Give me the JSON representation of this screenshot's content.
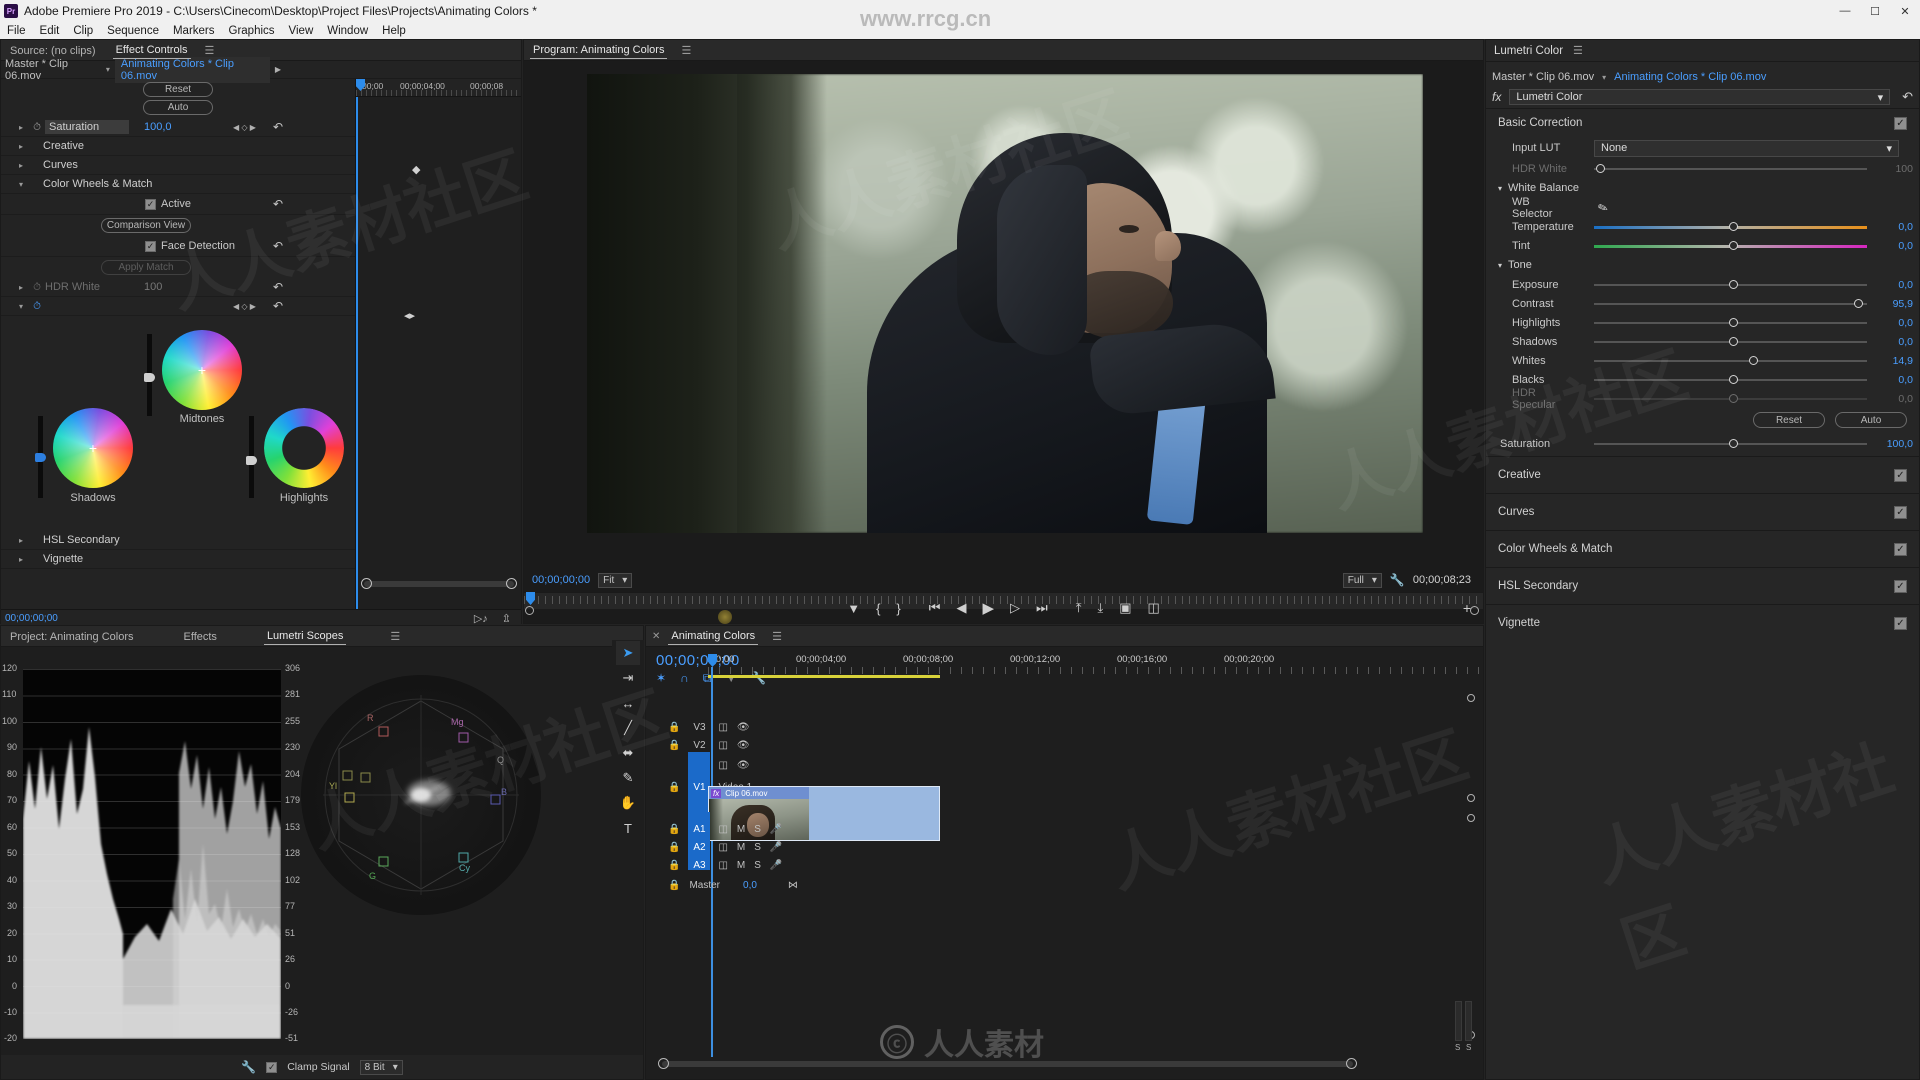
{
  "titlebar": {
    "app_icon": "premiere-logo",
    "title": "Adobe Premiere Pro 2019 - C:\\Users\\Cinecom\\Desktop\\Project Files\\Projects\\Animating Colors *",
    "minimize": "—",
    "maximize": "☐",
    "close": "✕"
  },
  "menubar": {
    "items": [
      "File",
      "Edit",
      "Clip",
      "Sequence",
      "Markers",
      "Graphics",
      "View",
      "Window",
      "Help"
    ]
  },
  "watermark": {
    "top": "www.rrcg.cn",
    "brand": "人人素材"
  },
  "effect_controls": {
    "tabs": [
      {
        "label": "Source: (no clips)",
        "active": false
      },
      {
        "label": "Effect Controls",
        "active": true
      }
    ],
    "menu_icon": "hamburger-icon",
    "master_clip": "Master * Clip 06.mov",
    "sequence_clip": "Animating Colors * Clip 06.mov",
    "ruler_ticks": [
      "00;00",
      "00;00;04;00",
      "00;00;08"
    ],
    "buttons": {
      "reset": "Reset",
      "auto": "Auto",
      "comparison_view": "Comparison View",
      "apply_match": "Apply Match"
    },
    "rows": [
      {
        "label": "Saturation",
        "value": "100,0",
        "indent": 1,
        "selected": true,
        "stopwatch": true
      },
      {
        "label": "Creative",
        "value": "",
        "indent": 0
      },
      {
        "label": "Curves",
        "value": "",
        "indent": 0
      },
      {
        "label": "Color Wheels & Match",
        "value": "",
        "indent": 0,
        "expanded": true
      },
      {
        "label": "HDR White",
        "value": "100",
        "indent": 1,
        "dim": true,
        "stopwatch": true
      }
    ],
    "checkboxes": [
      {
        "label": "Active",
        "checked": true
      },
      {
        "label": "Face Detection",
        "checked": true
      }
    ],
    "wheels": [
      {
        "label": "Midtones",
        "type": "solid"
      },
      {
        "label": "Shadows",
        "type": "solid"
      },
      {
        "label": "Highlights",
        "type": "ring"
      }
    ],
    "bottom_rows": [
      {
        "label": "HSL Secondary"
      },
      {
        "label": "Vignette"
      }
    ],
    "footer_timecode": "00;00;00;00"
  },
  "program_monitor": {
    "tab_label": "Program: Animating Colors",
    "menu_icon": "hamburger-icon",
    "current_timecode": "00;00;00;00",
    "fit_label": "Fit",
    "quality_label": "Full",
    "duration_timecode": "00;00;08;23",
    "settings_icon": "wrench-icon",
    "transport": [
      {
        "name": "add-marker-icon",
        "glyph": "▼"
      },
      {
        "name": "mark-in-icon",
        "glyph": "{"
      },
      {
        "name": "mark-out-icon",
        "glyph": "}"
      },
      {
        "name": "go-to-in-icon",
        "glyph": "⏮"
      },
      {
        "name": "step-back-icon",
        "glyph": "◀"
      },
      {
        "name": "play-icon",
        "glyph": "▶"
      },
      {
        "name": "step-forward-icon",
        "glyph": "▷"
      },
      {
        "name": "go-to-out-icon",
        "glyph": "⏭"
      },
      {
        "name": "lift-icon",
        "glyph": "⤒"
      },
      {
        "name": "extract-icon",
        "glyph": "⤓"
      },
      {
        "name": "export-frame-icon",
        "glyph": "▣"
      },
      {
        "name": "comparison-view-icon",
        "glyph": "◫"
      }
    ],
    "plus_button": "+"
  },
  "lumetri": {
    "panel_title": "Lumetri Color",
    "menu_icon": "hamburger-icon",
    "master_clip": "Master * Clip 06.mov",
    "sequence_clip": "Animating Colors * Clip 06.mov",
    "fx_label": "fx",
    "effect_name": "Lumetri Color",
    "reset_icon": "reset-icon",
    "sections": [
      {
        "name": "Basic Correction",
        "checked": true,
        "input_lut": {
          "label": "Input LUT",
          "value": "None"
        },
        "hdr_white": {
          "label": "HDR White",
          "value": "100",
          "dim": true,
          "knob_pct": 2
        },
        "groups": [
          {
            "name": "White Balance",
            "wb_selector": {
              "label": "WB Selector",
              "icon": "eyedropper-icon"
            },
            "sliders": [
              {
                "label": "Temperature",
                "value": "0,0",
                "knob_pct": 50,
                "gradient": "temperature"
              },
              {
                "label": "Tint",
                "value": "0,0",
                "knob_pct": 50,
                "gradient": "tint"
              }
            ]
          },
          {
            "name": "Tone",
            "sliders": [
              {
                "label": "Exposure",
                "value": "0,0",
                "knob_pct": 50
              },
              {
                "label": "Contrast",
                "value": "95,9",
                "knob_pct": 97
              },
              {
                "label": "Highlights",
                "value": "0,0",
                "knob_pct": 50
              },
              {
                "label": "Shadows",
                "value": "0,0",
                "knob_pct": 50
              },
              {
                "label": "Whites",
                "value": "14,9",
                "knob_pct": 58
              },
              {
                "label": "Blacks",
                "value": "0,0",
                "knob_pct": 50
              },
              {
                "label": "HDR Specular",
                "value": "0,0",
                "knob_pct": 50,
                "dim": true
              }
            ],
            "buttons": {
              "reset": "Reset",
              "auto": "Auto"
            }
          }
        ],
        "saturation": {
          "label": "Saturation",
          "value": "100,0",
          "knob_pct": 50
        }
      }
    ],
    "collapsed_sections": [
      {
        "name": "Creative",
        "checked": true
      },
      {
        "name": "Curves",
        "checked": true
      },
      {
        "name": "Color Wheels & Match",
        "checked": true
      },
      {
        "name": "HSL Secondary",
        "checked": true
      },
      {
        "name": "Vignette",
        "checked": true
      }
    ]
  },
  "scopes": {
    "tabs": [
      {
        "label": "Project: Animating Colors",
        "active": false
      },
      {
        "label": "Effects",
        "active": false
      },
      {
        "label": "Lumetri Scopes",
        "active": true
      }
    ],
    "menu_icon": "hamburger-icon",
    "left_axis": [
      "120",
      "110",
      "100",
      "90",
      "80",
      "70",
      "60",
      "50",
      "40",
      "30",
      "20",
      "10",
      "0",
      "-10",
      "-20"
    ],
    "right_axis": [
      "306",
      "281",
      "255",
      "230",
      "204",
      "179",
      "153",
      "128",
      "102",
      "77",
      "51",
      "26",
      "0",
      "-26",
      "-51"
    ],
    "vector_labels": [
      "R",
      "Mg",
      "B",
      "Cy",
      "G",
      "Yl",
      "Q"
    ],
    "settings_icon": "wrench-icon",
    "clamp_signal": {
      "label": "Clamp Signal",
      "checked": true
    },
    "bit_depth": "8 Bit"
  },
  "timeline": {
    "tab_label": "Animating Colors",
    "close_icon": "close-icon",
    "menu_icon": "hamburger-icon",
    "playhead_timecode": "00;00;00;00",
    "header_icons": [
      {
        "name": "nest-sequence-icon",
        "glyph": "✶"
      },
      {
        "name": "snap-icon",
        "glyph": "∩"
      },
      {
        "name": "linked-selection-icon",
        "glyph": "⧉"
      },
      {
        "name": "marker-icon",
        "glyph": "▼"
      },
      {
        "name": "timeline-settings-icon",
        "glyph": "🔧"
      }
    ],
    "ruler_ticks": [
      ";00;00",
      "00;00;04;00",
      "00;00;08;00",
      "00;00;12;00",
      "00;00;16;00",
      "00;00;20;00"
    ],
    "video_tracks": [
      {
        "name": "V3",
        "label": "",
        "selected": false
      },
      {
        "name": "V2",
        "label": "",
        "selected": false
      },
      {
        "name": "V1",
        "label": "Video 1",
        "selected": true
      }
    ],
    "audio_tracks": [
      {
        "name": "A1",
        "mute": "M",
        "solo": "S",
        "selected": true
      },
      {
        "name": "A2",
        "mute": "M",
        "solo": "S",
        "selected": true
      },
      {
        "name": "A3",
        "mute": "M",
        "solo": "S",
        "selected": true
      }
    ],
    "master_track": {
      "name": "Master",
      "value": "0,0"
    },
    "clip": {
      "name": "Clip 06.mov",
      "fx_badge": "fx"
    },
    "audio_meter_labels": [
      "S",
      "S"
    ]
  },
  "tools": [
    {
      "name": "selection-tool",
      "glyph": "➤",
      "active": true
    },
    {
      "name": "track-select-forward-tool",
      "glyph": "⇥"
    },
    {
      "name": "ripple-edit-tool",
      "glyph": "↔"
    },
    {
      "name": "razor-tool",
      "glyph": "╱"
    },
    {
      "name": "slip-tool",
      "glyph": "⬌"
    },
    {
      "name": "pen-tool",
      "glyph": "✎"
    },
    {
      "name": "hand-tool",
      "glyph": "✋"
    },
    {
      "name": "type-tool",
      "glyph": "T"
    }
  ],
  "colors": {
    "accent_blue": "#4a9eff",
    "panel_bg": "#232323",
    "track_select": "#1b6ac9",
    "clip_blue": "#8aadde",
    "work_area_yellow": "#d8d23a"
  }
}
